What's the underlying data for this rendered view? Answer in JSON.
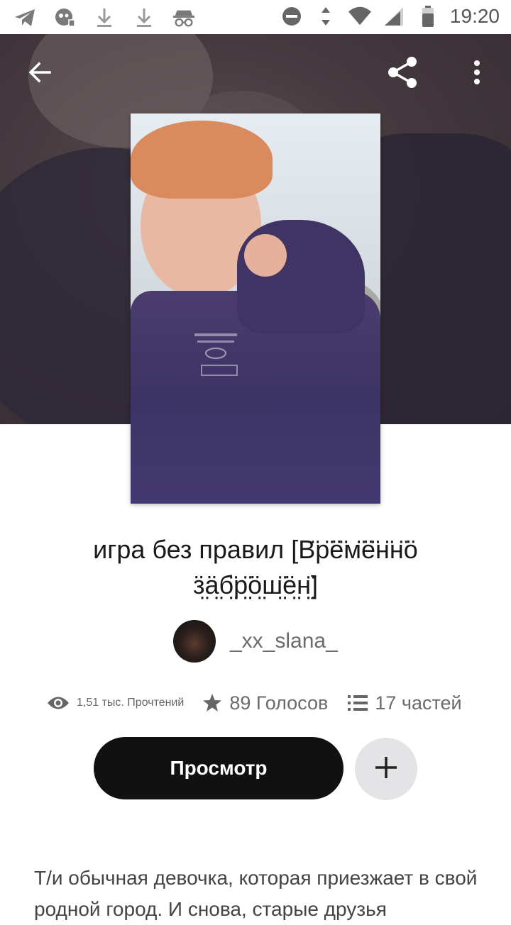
{
  "status_bar": {
    "time": "19:20",
    "left_icons": [
      "telegram-icon",
      "mask-notification-icon",
      "download-icon",
      "download-icon",
      "incognito-icon"
    ],
    "right_icons": [
      "do-not-disturb-icon",
      "data-arrows-icon",
      "wifi-icon",
      "signal-icon",
      "battery-icon"
    ]
  },
  "toolbar": {
    "back_icon": "arrow-left-icon",
    "share_icon": "share-icon",
    "more_icon": "more-vert-icon"
  },
  "story": {
    "title": "игра без правил [В̈р̈ё̈м̈ё̈н̈н̈ӧ ӟ̤ӓ̤б̤̈р̤̈ӧ̤ш̤̈ё̤н̤̈]",
    "author": "_xx_slana_",
    "stats": {
      "reads": "1,51 тыс. Прочтений",
      "votes": "89 Голосов",
      "parts": "17 частей"
    },
    "view_button": "Просмотр",
    "add_button_icon": "plus-icon",
    "description": "Т/и обычная девочка, которая приезжает в свой родной город. И снова, старые друзья"
  },
  "colors": {
    "primary_button": "#111111",
    "secondary_button": "#e4e4e6",
    "muted_text": "#6b6b6b"
  }
}
